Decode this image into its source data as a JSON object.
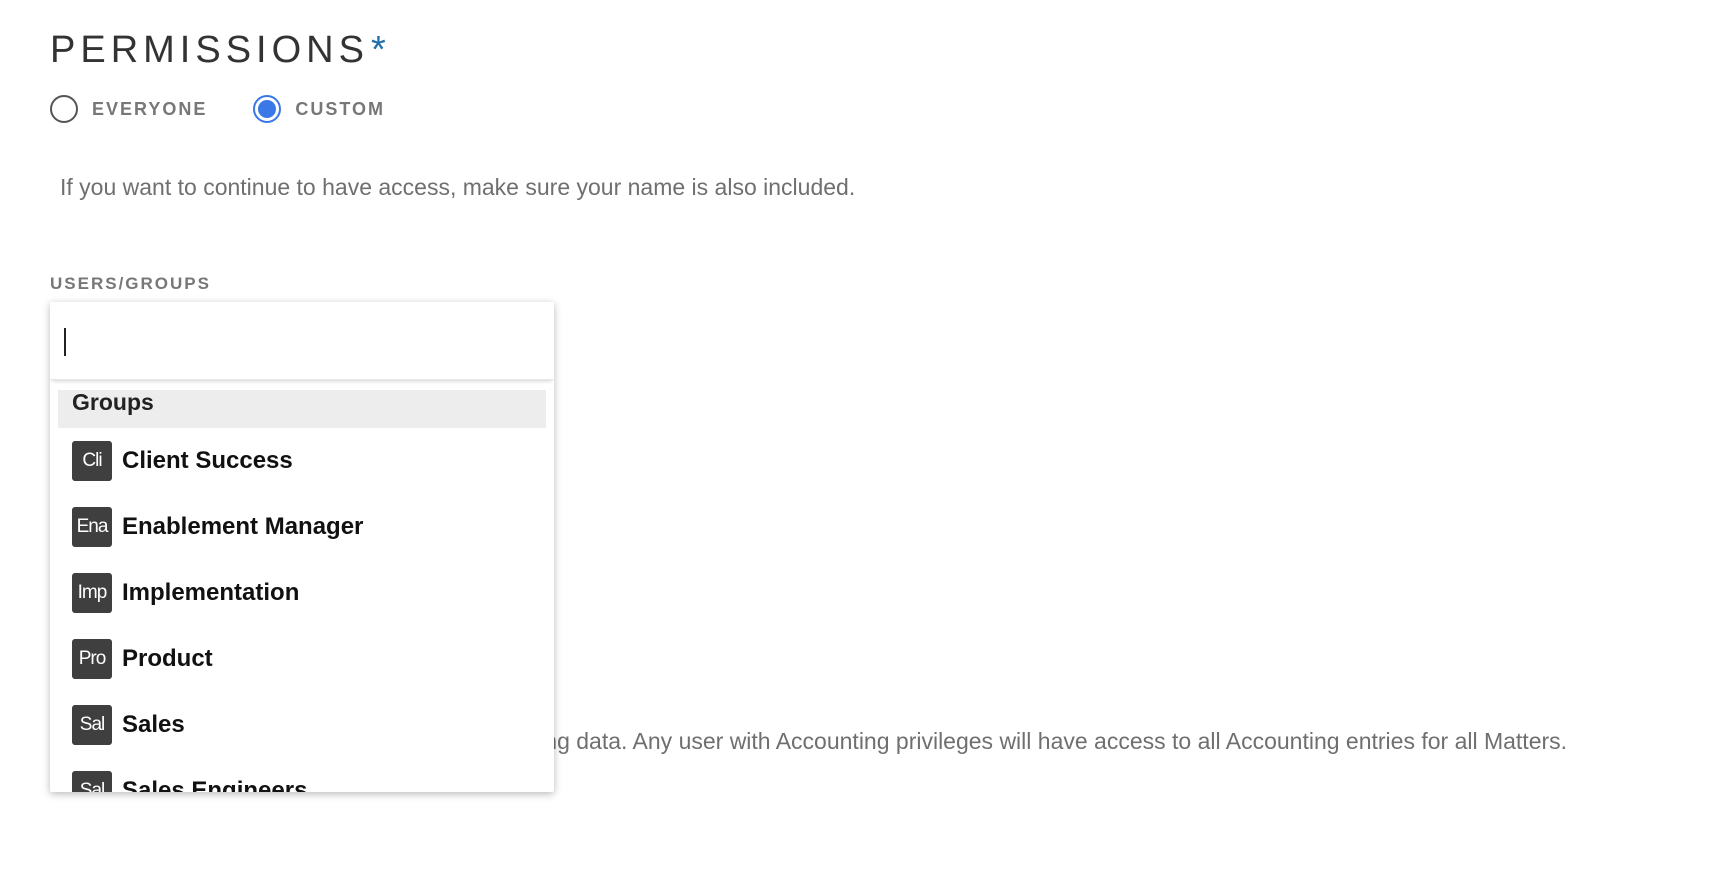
{
  "permissions": {
    "title": "PERMISSIONS",
    "required_marker": "*",
    "options": [
      {
        "label": "EVERYONE",
        "selected": false
      },
      {
        "label": "CUSTOM",
        "selected": true
      }
    ],
    "help_text": "If you want to continue to have access, make sure your name is also included."
  },
  "users_groups": {
    "label": "USERS/GROUPS",
    "search_value": "",
    "dropdown": {
      "section_header": "Groups",
      "items": [
        {
          "abbr": "Cli",
          "label": "Client Success"
        },
        {
          "abbr": "Ena",
          "label": "Enablement Manager"
        },
        {
          "abbr": "Imp",
          "label": "Implementation"
        },
        {
          "abbr": "Pro",
          "label": "Product"
        },
        {
          "abbr": "Sal",
          "label": "Sales"
        },
        {
          "abbr": "Sal",
          "label": "Sales Engineers"
        }
      ]
    }
  },
  "accounting_note": {
    "visible_text": "nting data. Any user with Accounting privileges will have access to all Accounting entries for all Matters."
  },
  "colors": {
    "accent": "#3b78e7",
    "required_star": "#1f6fa8",
    "avatar_bg": "#3f3f3f",
    "group_header_bg": "#ededed"
  },
  "icons": {
    "radio_unselected": "radio-unchecked-icon",
    "radio_selected": "radio-checked-icon",
    "avatar": "group-avatar-icon"
  }
}
